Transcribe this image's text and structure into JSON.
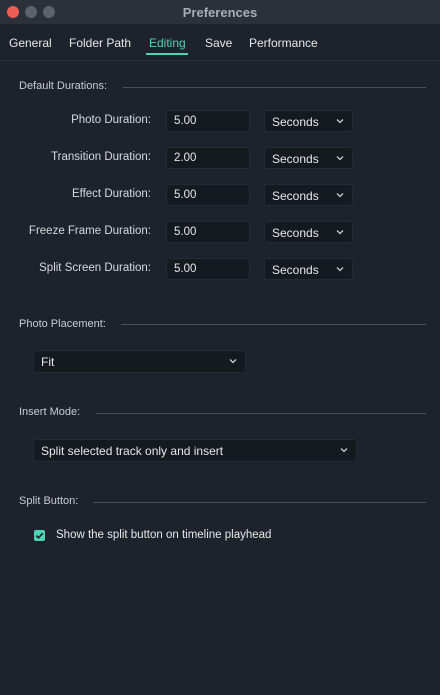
{
  "window": {
    "title": "Preferences"
  },
  "tabs": [
    {
      "label": "General",
      "active": false
    },
    {
      "label": "Folder Path",
      "active": false
    },
    {
      "label": "Editing",
      "active": true
    },
    {
      "label": "Save",
      "active": false
    },
    {
      "label": "Performance",
      "active": false
    }
  ],
  "default_durations": {
    "heading": "Default Durations:",
    "rows": [
      {
        "label": "Photo Duration:",
        "value": "5.00",
        "unit": "Seconds"
      },
      {
        "label": "Transition Duration:",
        "value": "2.00",
        "unit": "Seconds"
      },
      {
        "label": "Effect Duration:",
        "value": "5.00",
        "unit": "Seconds"
      },
      {
        "label": "Freeze Frame Duration:",
        "value": "5.00",
        "unit": "Seconds"
      },
      {
        "label": "Split Screen Duration:",
        "value": "5.00",
        "unit": "Seconds"
      }
    ]
  },
  "photo_placement": {
    "heading": "Photo Placement:",
    "selected": "Fit"
  },
  "insert_mode": {
    "heading": "Insert Mode:",
    "selected": "Split selected track only and insert"
  },
  "split_button": {
    "heading": "Split Button:",
    "checkbox_label": "Show the split button on timeline playhead",
    "checked": true
  },
  "colors": {
    "accent": "#4fd3b6",
    "background": "#1e232b",
    "field": "#151920",
    "titlebar": "#2b3039"
  },
  "icons": {
    "dropdown": "chevron-down-icon",
    "check": "checkmark-icon"
  }
}
